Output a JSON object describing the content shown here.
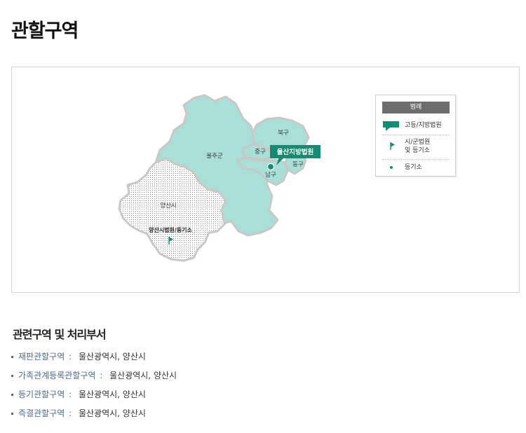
{
  "page": {
    "title": "관할구역"
  },
  "map": {
    "regions": {
      "ulju": "울주군",
      "buk": "북구",
      "jung": "중구",
      "dong": "동구",
      "nam": "남구",
      "yangsan": "양산시"
    },
    "courts": {
      "ulsan_district": "울산지방법원",
      "yangsan_branch": "양산시법원/등기소"
    },
    "colors": {
      "ulsan_fill": "#a9dfd8",
      "yangsan_fill": "#ffffff",
      "court_badge": "#178a73",
      "outline": "#c8c8c8"
    },
    "legend": {
      "title": "범례",
      "items": [
        {
          "icon": "speech-bubble-icon",
          "label": "고등/지방법원"
        },
        {
          "icon": "flag-icon",
          "label_line1": "시/군법원",
          "label_line2": "및 등기소"
        },
        {
          "icon": "dot-icon",
          "label": "등기소"
        }
      ]
    }
  },
  "related": {
    "title": "관련구역 및 처리부서",
    "items": [
      {
        "key": "재판관할구역",
        "sep": ":",
        "value": "울산광역시, 양산시"
      },
      {
        "key": "가족관계등록관할구역",
        "sep": ":",
        "value": "울산광역시, 양산시"
      },
      {
        "key": "등기관할구역",
        "sep": ":",
        "value": "울산광역시, 양산시"
      },
      {
        "key": "즉결관할구역",
        "sep": ":",
        "value": "울산광역시, 양산시"
      }
    ]
  }
}
